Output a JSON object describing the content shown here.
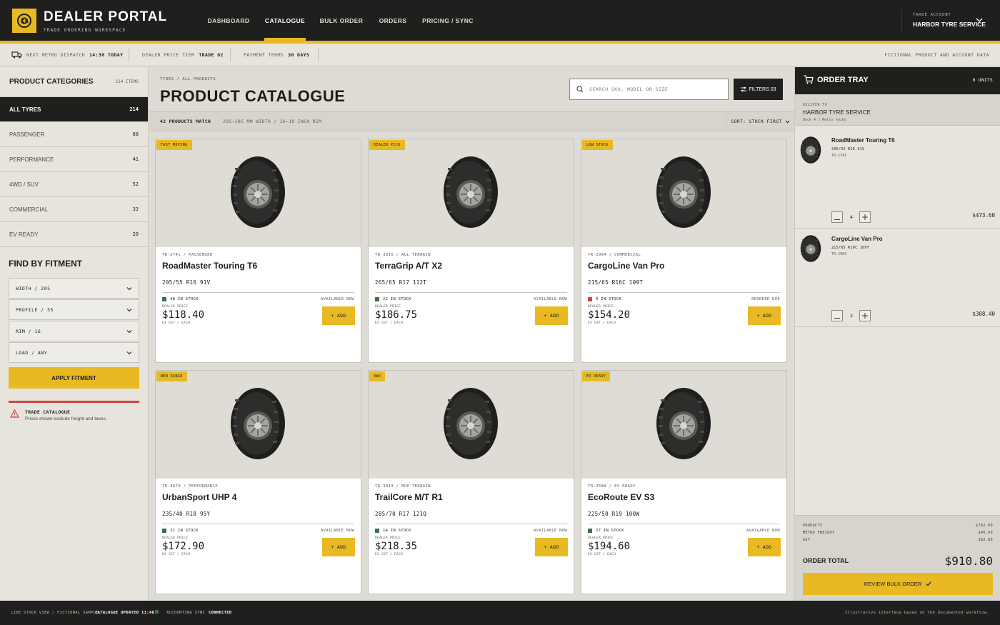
{
  "topbar": {
    "brand": "DEALER PORTAL",
    "brand_sub": "TRADE ORDERING WORKSPACE",
    "nav": [
      {
        "label": "DASHBOARD",
        "active": false
      },
      {
        "label": "CATALOGUE",
        "active": true
      },
      {
        "label": "BULK ORDER",
        "active": false
      },
      {
        "label": "ORDERS",
        "active": false
      },
      {
        "label": "PRICING / SYNC",
        "active": false
      }
    ],
    "account_label": "TRADE ACCOUNT",
    "account_name": "HARBOR TYRE SERVICE"
  },
  "strip": {
    "dispatch_label": "NEXT METRO DISPATCH",
    "dispatch_value": "14:30 TODAY",
    "tier_label": "DEALER PRICE TIER",
    "tier_value": "TRADE 02",
    "terms_label": "PAYMENT TERMS",
    "terms_value": "30 DAYS",
    "disclaimer": "FICTIONAL PRODUCT AND ACCOUNT DATA"
  },
  "sidebar": {
    "title": "PRODUCT CATEGORIES",
    "count": "214 ITEMS",
    "categories": [
      {
        "label": "ALL TYRES",
        "count": "214",
        "active": true
      },
      {
        "label": "PASSENGER",
        "count": "68"
      },
      {
        "label": "PERFORMANCE",
        "count": "41"
      },
      {
        "label": "4WD / SUV",
        "count": "52"
      },
      {
        "label": "COMMERCIAL",
        "count": "33"
      },
      {
        "label": "EV READY",
        "count": "20"
      }
    ],
    "fitment_title": "FIND BY FITMENT",
    "fitment": [
      "WIDTH / 205",
      "PROFILE / 55",
      "RIM / 16",
      "LOAD / ANY"
    ],
    "apply_label": "APPLY FITMENT",
    "note_title": "TRADE CATALOGUE",
    "note_text": "Prices shown exclude freight and taxes."
  },
  "main": {
    "breadcrumb": "TYRES / ALL PRODUCTS",
    "title": "PRODUCT CATALOGUE",
    "search_placeholder": "SEARCH SKU, MODEL OR SIZE",
    "filters_label": "FILTERS 03",
    "match_count": "42 PRODUCTS MATCH",
    "match_filter": "205–285 MM WIDTH / 16–19 INCH RIM",
    "sort_label": "SORT: STOCK FIRST"
  },
  "products": [
    {
      "badge": "FAST MOVING",
      "sku": "TR-2741 / PASSENGER",
      "name": "RoadMaster Touring T6",
      "spec": "205/55 R16 91V",
      "stock": "48 IN STOCK",
      "stock_color": "#3f6e4f",
      "availability": "AVAILABLE NOW",
      "price_label": "DEALER PRICE",
      "price": "$118.40",
      "price_note": "EX GST / EACH",
      "add_label": "+ ADD"
    },
    {
      "badge": "DEALER PICK",
      "sku": "TR-3816 / ALL TERRAIN",
      "name": "TerraGrip A/T X2",
      "spec": "265/65 R17 112T",
      "stock": "22 IN STOCK",
      "stock_color": "#3f6e4f",
      "availability": "AVAILABLE NOW",
      "price_label": "DEALER PRICE",
      "price": "$186.75",
      "price_note": "EX GST / EACH",
      "add_label": "+ ADD"
    },
    {
      "badge": "LOW STOCK",
      "sku": "TR-2904 / COMMERCIAL",
      "name": "CargoLine Van Pro",
      "spec": "215/65 R16C 109T",
      "stock": "9 IN STOCK",
      "stock_color": "#c9483f",
      "availability": "REORDER DUE",
      "price_label": "DEALER PRICE",
      "price": "$154.20",
      "price_note": "EX GST / EACH",
      "add_label": "+ ADD"
    },
    {
      "badge": "NEW RANGE",
      "sku": "TR-3670 / PERFORMANCE",
      "name": "UrbanSport UHP 4",
      "spec": "235/40 R18 95Y",
      "stock": "31 IN STOCK",
      "stock_color": "#3f6e4f",
      "availability": "AVAILABLE NOW",
      "price_label": "DEALER PRICE",
      "price": "$172.90",
      "price_note": "EX GST / EACH",
      "add_label": "+ ADD"
    },
    {
      "badge": "4WD",
      "sku": "TR-3013 / MUD TERRAIN",
      "name": "TrailCore M/T R1",
      "spec": "285/70 R17 121Q",
      "stock": "14 IN STOCK",
      "stock_color": "#3f6e4f",
      "availability": "AVAILABLE NOW",
      "price_label": "DEALER PRICE",
      "price": "$218.35",
      "price_note": "EX GST / EACH",
      "add_label": "+ ADD"
    },
    {
      "badge": "EV READY",
      "sku": "TR-2588 / EV READY",
      "name": "EcoRoute EV S3",
      "spec": "225/50 R19 100W",
      "stock": "27 IN STOCK",
      "stock_color": "#3f6e4f",
      "availability": "AVAILABLE NOW",
      "price_label": "DEALER PRICE",
      "price": "$194.60",
      "price_note": "EX GST / EACH",
      "add_label": "+ ADD"
    }
  ],
  "tray": {
    "title": "ORDER TRAY",
    "units": "6 UNITS",
    "deliver_label": "DELIVER TO",
    "deliver_name": "HARBOR TYRE SERVICE",
    "deliver_route": "Dock 4 / Metro route",
    "items": [
      {
        "name": "RoadMaster Touring T6",
        "spec": "205/55 R16 91V",
        "sku": "TR-2741",
        "qty": "4",
        "total": "$473.60"
      },
      {
        "name": "CargoLine Van Pro",
        "spec": "215/65 R16C 109T",
        "sku": "TR-2904",
        "qty": "2",
        "total": "$308.40"
      }
    ],
    "products_label": "PRODUCTS",
    "products_value": "$782.00",
    "freight_label": "METRO FREIGHT",
    "freight_value": "$46.00",
    "gst_label": "GST",
    "gst_value": "$82.80",
    "total_label": "ORDER TOTAL",
    "total_value": "$910.80",
    "review_label": "REVIEW BULK ORDER"
  },
  "footer": {
    "left": "LIVE STOCK VIEW / FICTIONAL SAMPLE",
    "updated": "CATALOGUE UPDATED 11:46",
    "sync_label": "ACCOUNTING SYNC",
    "sync_status": "CONNECTED",
    "right": "Illustrative interface based on the documented workflow."
  },
  "colors": {
    "accent": "#e8b923",
    "dark": "#1f201e",
    "in_stock": "#3f6e4f",
    "low_stock": "#c9483f"
  }
}
